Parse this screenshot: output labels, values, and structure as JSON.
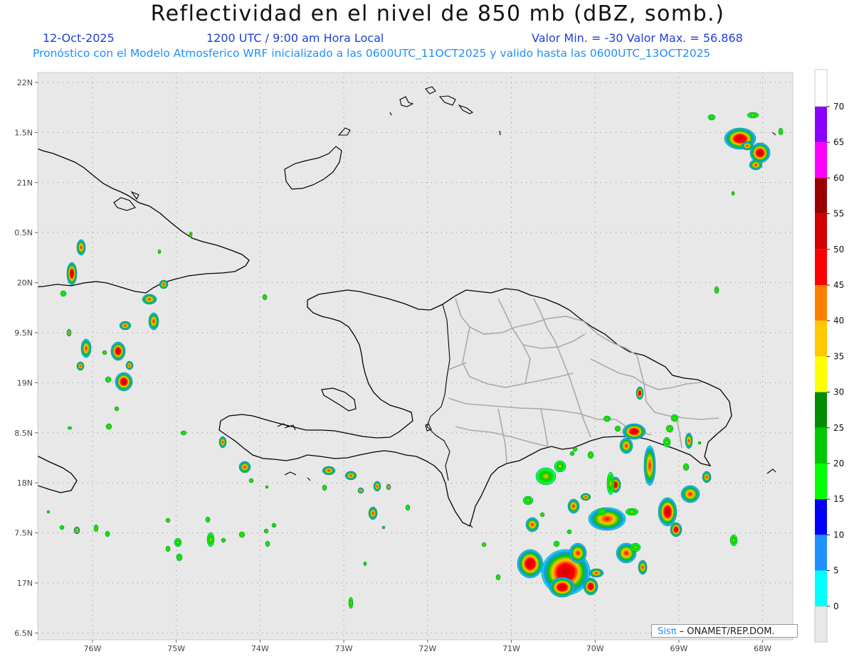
{
  "header": {
    "title": "Reflectividad en el nivel de 850 mb (dBZ, somb.)",
    "date": "12-Oct-2025",
    "time": "1200 UTC / 9:00 am Hora Local",
    "minmax": "Valor Min. = -30  Valor Max. = 56.868",
    "model_line": "Pronóstico con el Modelo Atmosferico WRF inicializado a las 0600UTC_11OCT2025 y valido hasta las  0600UTC_13OCT2025"
  },
  "map": {
    "lat_labels": [
      "22N",
      "1.5N",
      "21N",
      "0.5N",
      "20N",
      "9.5N",
      "19N",
      "8.5N",
      "18N",
      "7.5N",
      "17N",
      "6.5N"
    ],
    "lon_labels": [
      "76W",
      "75W",
      "74W",
      "73W",
      "72W",
      "71W",
      "70W",
      "69W",
      "68W"
    ],
    "background_color": "#e8e8e8",
    "coast_color": "#000000",
    "province_color": "#a9a9a9"
  },
  "colorbar": {
    "levels": [
      "0",
      "5",
      "10",
      "15",
      "20",
      "25",
      "30",
      "35",
      "40",
      "45",
      "50",
      "55",
      "60",
      "65",
      "70"
    ],
    "colors": [
      "#00ffff",
      "#1e90ff",
      "#0000ff",
      "#00ff00",
      "#00c800",
      "#008c00",
      "#ffff00",
      "#ffc800",
      "#ff8000",
      "#ff0000",
      "#d20000",
      "#9a0000",
      "#ff00ff",
      "#8c00ff"
    ]
  },
  "credit": {
    "logo": "Sisπ",
    "text": " – ONAMET/REP.DOM."
  }
}
